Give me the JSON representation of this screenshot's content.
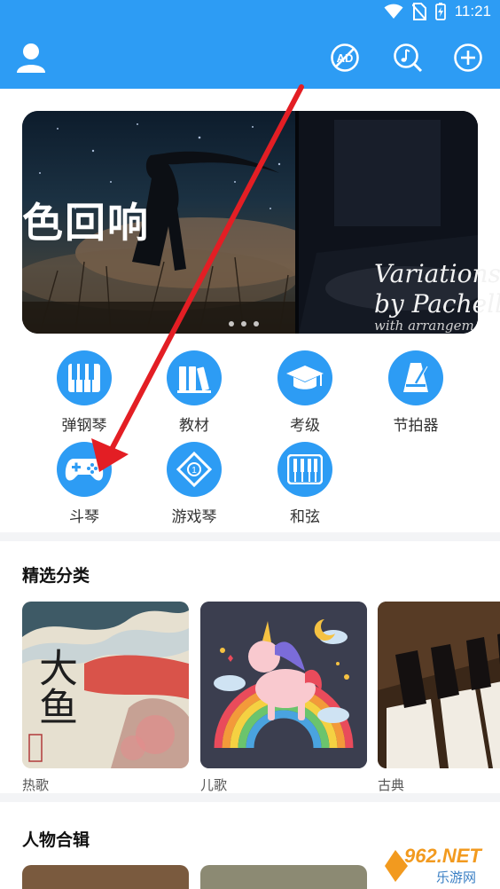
{
  "status_bar": {
    "time": "11:21"
  },
  "app_bar": {
    "actions": [
      "ad-free-icon",
      "music-search-icon",
      "add-icon"
    ]
  },
  "banner": {
    "left_title": "色回响",
    "right_title_line1": "Variations",
    "right_title_line2": "by Pachell",
    "right_title_line3": "with arrangem",
    "page_count": 3
  },
  "features": [
    {
      "label": "弹钢琴",
      "icon": "piano-keys-icon"
    },
    {
      "label": "教材",
      "icon": "books-icon"
    },
    {
      "label": "考级",
      "icon": "graduation-cap-icon"
    },
    {
      "label": "节拍器",
      "icon": "metronome-icon"
    },
    {
      "label": "斗琴",
      "icon": "gamepad-icon"
    },
    {
      "label": "游戏琴",
      "icon": "rhythm-tile-icon"
    },
    {
      "label": "和弦",
      "icon": "chord-keys-icon"
    }
  ],
  "categories": {
    "title": "精选分类",
    "items": [
      {
        "label": "热歌",
        "cover_text": "大鱼"
      },
      {
        "label": "儿歌"
      },
      {
        "label": "古典"
      }
    ]
  },
  "people": {
    "title": "人物合辑"
  },
  "watermark": {
    "text1": "962.NET",
    "text2": "乐游网"
  },
  "colors": {
    "primary": "#2d9cf4",
    "arrow": "#e31e24"
  }
}
